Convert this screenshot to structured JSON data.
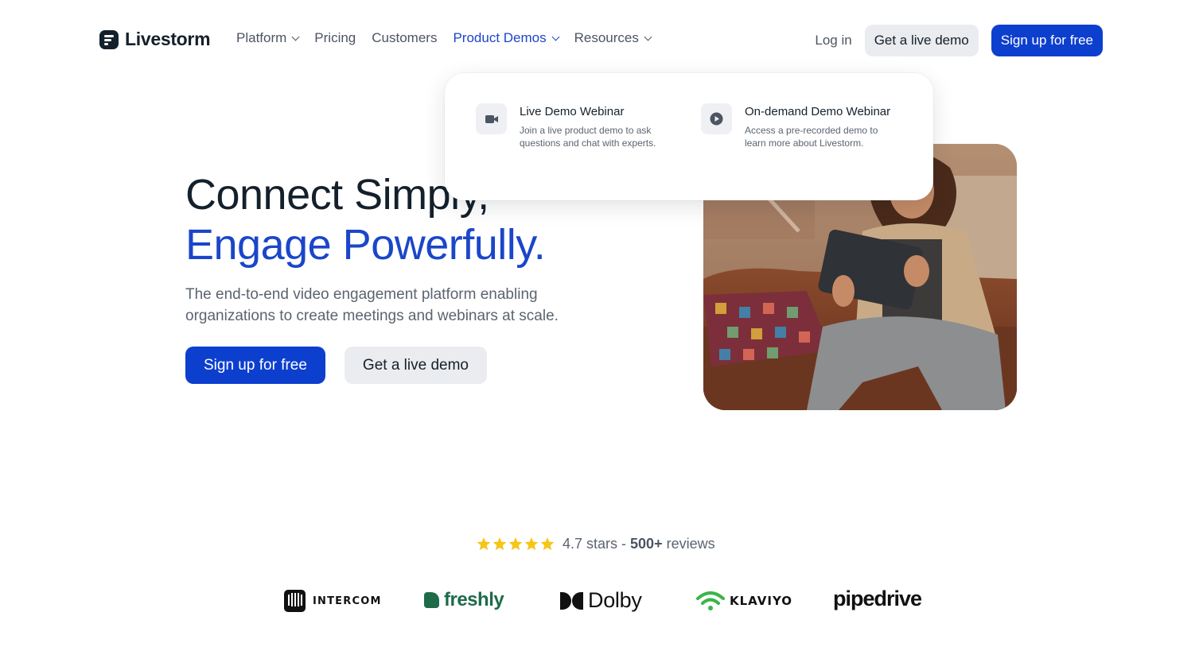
{
  "colors": {
    "primary": "#0d3fcf",
    "accent_text": "#1b46c9",
    "dark": "#14202b",
    "muted": "#5b6470",
    "star": "#f5c518"
  },
  "nav": {
    "logo_text": "Livestorm",
    "menu": [
      {
        "label": "Platform",
        "has_dropdown": true
      },
      {
        "label": "Pricing",
        "has_dropdown": false
      },
      {
        "label": "Customers",
        "has_dropdown": false
      },
      {
        "label": "Product Demos",
        "has_dropdown": true,
        "active": true
      },
      {
        "label": "Resources",
        "has_dropdown": true
      }
    ],
    "login": "Log in",
    "demo_button": "Get a live demo",
    "signup_button": "Sign up for free"
  },
  "dropdown": {
    "items": [
      {
        "icon": "video-camera-icon",
        "title": "Live Demo Webinar",
        "description": "Join a live product demo to ask questions and chat with experts."
      },
      {
        "icon": "play-circle-icon",
        "title": "On-demand Demo Webinar",
        "description": "Access a pre-recorded demo to learn more about Livestorm."
      }
    ]
  },
  "hero": {
    "headline_line1": "Connect Simply,",
    "headline_line2": "Engage Powerfully.",
    "subtitle": "The end-to-end video engagement platform enabling organizations to create meetings and webinars at scale.",
    "signup_button": "Sign up for free",
    "demo_button": "Get a live demo"
  },
  "rating": {
    "stars": 5,
    "stars_text": "4.7 stars - ",
    "reviews_count": "500+",
    "reviews_label": " reviews"
  },
  "logos": {
    "intercom": "INTERCOM",
    "freshly": "freshly",
    "dolby": "Dolby",
    "klaviyo": "KLAVIYO",
    "pipedrive": "pipedrive"
  }
}
